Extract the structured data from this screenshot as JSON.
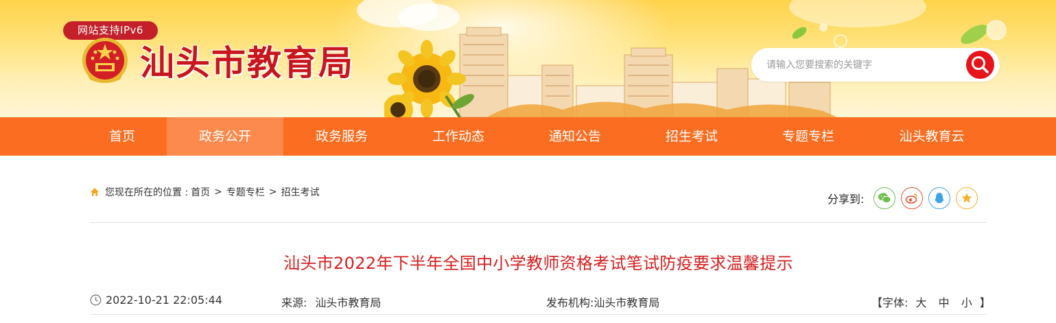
{
  "header": {
    "ipv6_badge": "网站支持IPv6",
    "site_title": "汕头市教育局",
    "search": {
      "placeholder": "请输入您要搜索的关键字",
      "value": ""
    }
  },
  "nav": {
    "items": [
      {
        "label": "首页",
        "active": false
      },
      {
        "label": "政务公开",
        "active": true
      },
      {
        "label": "政务服务",
        "active": false
      },
      {
        "label": "工作动态",
        "active": false
      },
      {
        "label": "通知公告",
        "active": false
      },
      {
        "label": "招生考试",
        "active": false
      },
      {
        "label": "专题专栏",
        "active": false
      },
      {
        "label": "汕头教育云",
        "active": false
      }
    ]
  },
  "breadcrumb": {
    "prefix": "您现在所在的位置 :",
    "items": [
      "首页",
      "专题专栏",
      "招生考试"
    ],
    "separator": ">"
  },
  "share": {
    "label": "分享到:",
    "targets": [
      {
        "icon": "wechat-icon",
        "color": "#6cbf4b"
      },
      {
        "icon": "weibo-icon",
        "color": "#e8542c"
      },
      {
        "icon": "qq-icon",
        "color": "#3aa4e8"
      },
      {
        "icon": "qzone-star-icon",
        "color": "#f2b22e"
      }
    ]
  },
  "article": {
    "title": "汕头市2022年下半年全国中小学教师资格考试笔试防疫要求温馨提示",
    "datetime": "2022-10-21 22:05:44",
    "source_label": "来源:",
    "source_value": "汕头市教育局",
    "publisher_label": "发布机构:",
    "publisher_value": "汕头市教育局",
    "font_size": {
      "open": "【字体:",
      "large": "大",
      "medium": "中",
      "small": "小",
      "close": "】"
    }
  },
  "colors": {
    "nav_bg": "#fb6d20",
    "nav_active": "#fd8a4d",
    "title_red": "#d61e1e",
    "brand_red": "#c8161d"
  }
}
